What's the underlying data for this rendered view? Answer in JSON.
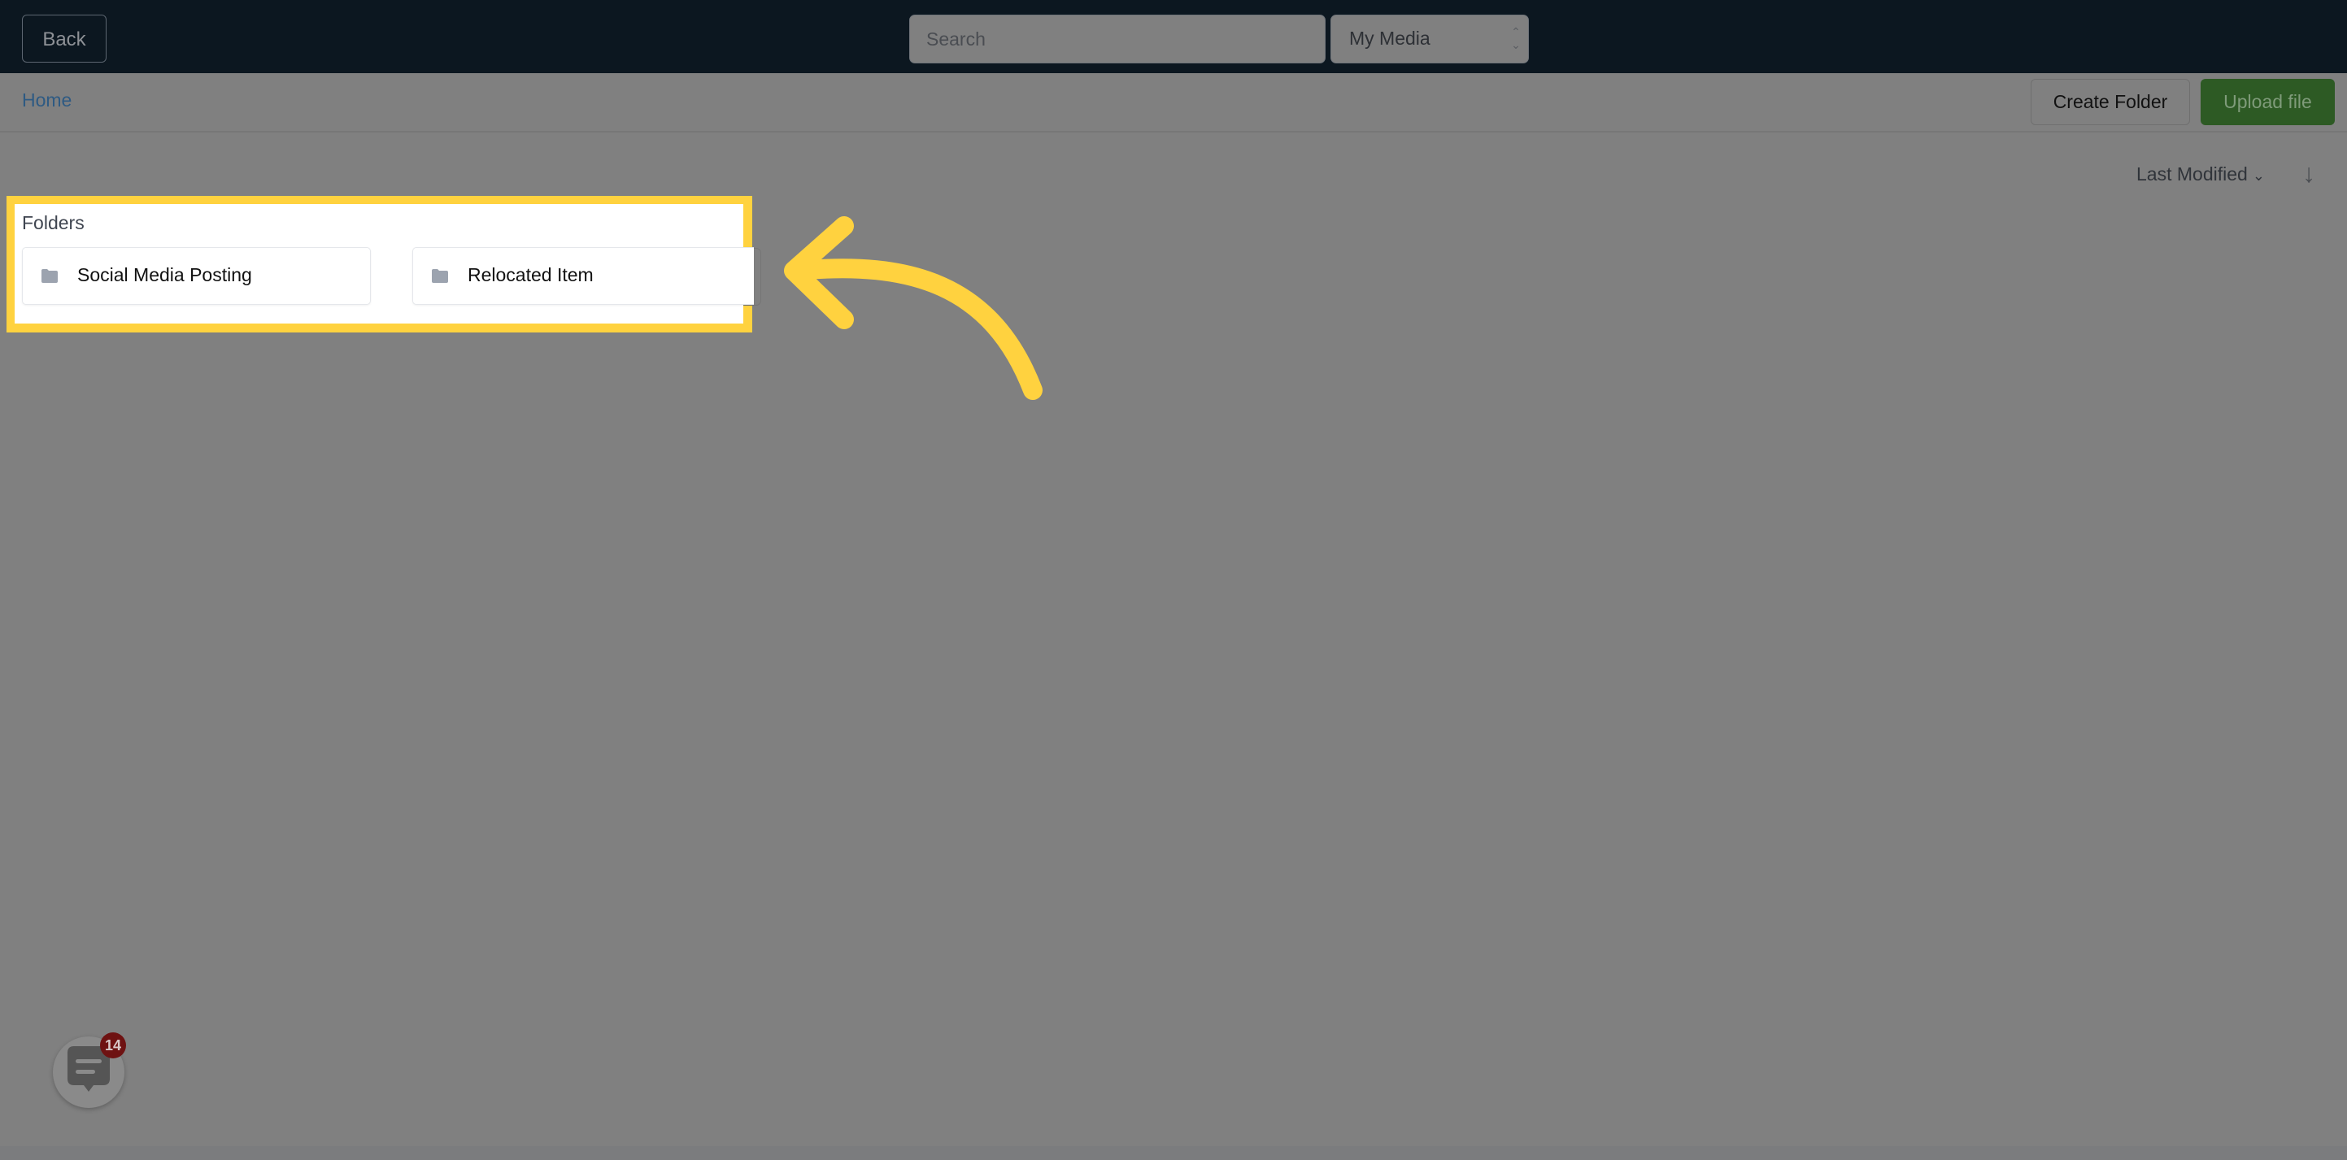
{
  "topbar": {
    "back_label": "Back",
    "search_placeholder": "Search",
    "scope_select_value": "My Media"
  },
  "breadcrumb": {
    "home_label": "Home"
  },
  "toolbar": {
    "create_folder_label": "Create Folder",
    "upload_file_label": "Upload file"
  },
  "sort": {
    "field_label": "Last Modified",
    "direction_icon": "arrow-down-icon"
  },
  "folders": {
    "section_label": "Folders",
    "items": [
      {
        "name": "Social Media Posting",
        "icon": "folder-icon"
      },
      {
        "name": "Relocated Item",
        "icon": "folder-icon"
      }
    ]
  },
  "chat_widget": {
    "icon": "chat-bubble-icon",
    "unread_count": "14"
  },
  "colors": {
    "topbar_bg": "#0c1720",
    "overlay_bg": "#808080",
    "highlight": "#ffd23f",
    "upload_button": "#2d5a24",
    "badge": "#6e1212",
    "link": "#2e5a83"
  }
}
